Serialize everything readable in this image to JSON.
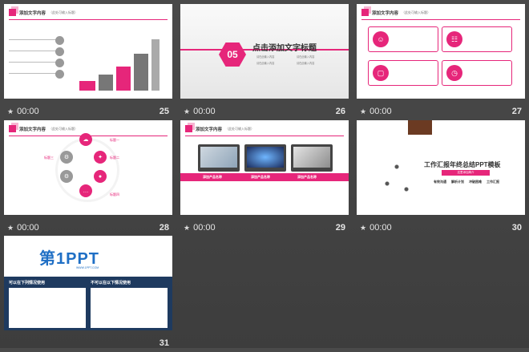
{
  "slides": [
    {
      "number": "25",
      "time": "00:00",
      "title": "添加文字内容",
      "subtitle": "（此处可输入标题）"
    },
    {
      "number": "26",
      "time": "00:00",
      "section_number": "05",
      "heading": "点击添加文字标题",
      "items": [
        "请在此输入内容",
        "请在此输入内容",
        "请在此输入内容",
        "请在此输入内容"
      ]
    },
    {
      "number": "27",
      "time": "00:00",
      "title": "添加文字内容",
      "subtitle": "（此处可输入标题）"
    },
    {
      "number": "28",
      "time": "00:00",
      "title": "添加文字内容",
      "subtitle": "（此处可输入标题）",
      "labels": [
        "标题三",
        "标题一",
        "标题二",
        "标题四"
      ]
    },
    {
      "number": "29",
      "time": "00:00",
      "title": "添加文字内容",
      "subtitle": "（此处可输入标题）",
      "product_titles": [
        "添加产品名称",
        "添加产品名称",
        "添加产品名称"
      ]
    },
    {
      "number": "30",
      "time": "00:00",
      "title": "工作汇报年终总结PPT模板",
      "subtitle": "这里添加简介",
      "tags": [
        "有效沟通",
        "解析计划",
        "冲破困难",
        "工作汇报"
      ]
    },
    {
      "number": "31",
      "logo": "第1PPT",
      "logo_sub": "WWW.1PPT.COM",
      "left_head": "可以在下列情况使用",
      "right_head": "不可以在以下情况使用"
    }
  ]
}
